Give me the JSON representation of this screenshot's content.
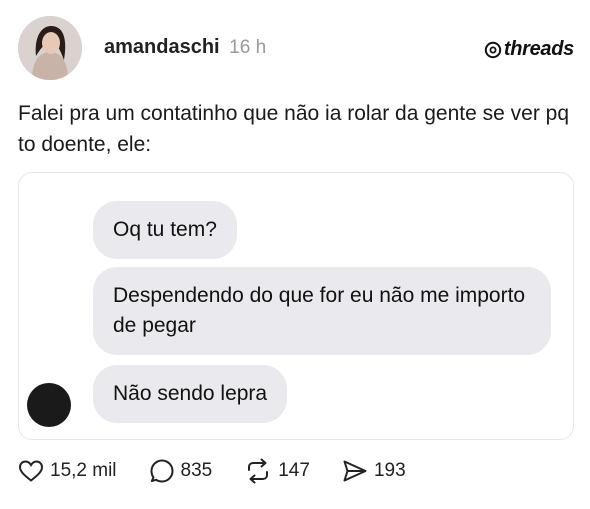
{
  "post": {
    "username": "amandaschi",
    "time": "16 h",
    "brand": "threads",
    "text": "Falei pra um contatinho que não ia rolar da gente se ver pq to doente, ele:"
  },
  "screenshot": {
    "messages": [
      "Oq tu tem?",
      "Despendendo do que for eu não me importo de pegar",
      "Não sendo lepra"
    ]
  },
  "actions": {
    "likes": "15,2 mil",
    "replies": "835",
    "reposts": "147",
    "shares": "193"
  }
}
